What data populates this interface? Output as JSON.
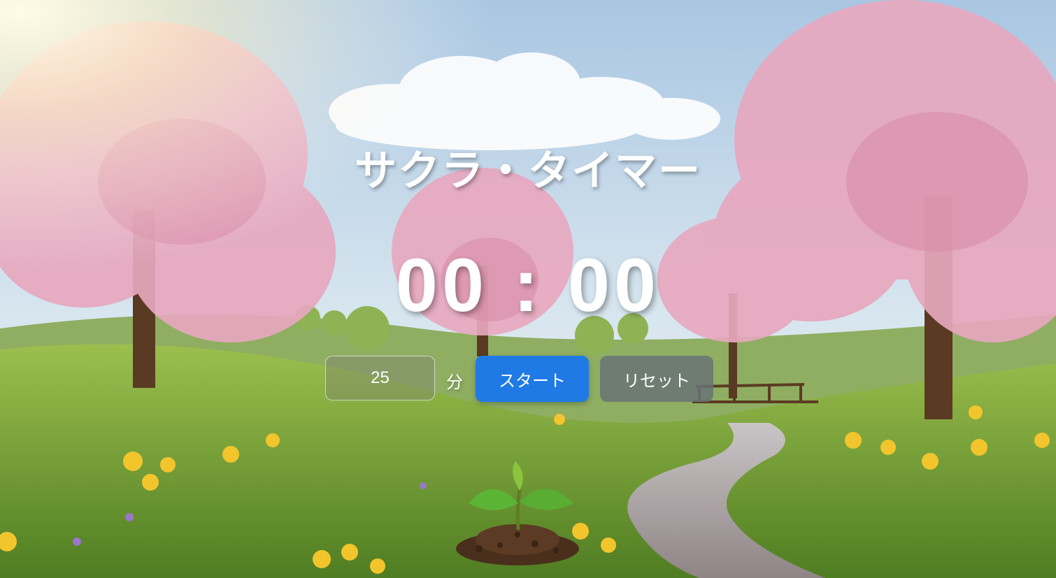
{
  "app": {
    "title": "サクラ・タイマー",
    "timer": "00 : 00",
    "minutes_value": "25",
    "minutes_unit": "分",
    "start_label": "スタート",
    "reset_label": "リセット"
  },
  "colors": {
    "start_button": "#1f7ae6",
    "reset_button": "#69737a",
    "text": "#ffffff"
  },
  "icons": [
    "sprout-icon"
  ]
}
